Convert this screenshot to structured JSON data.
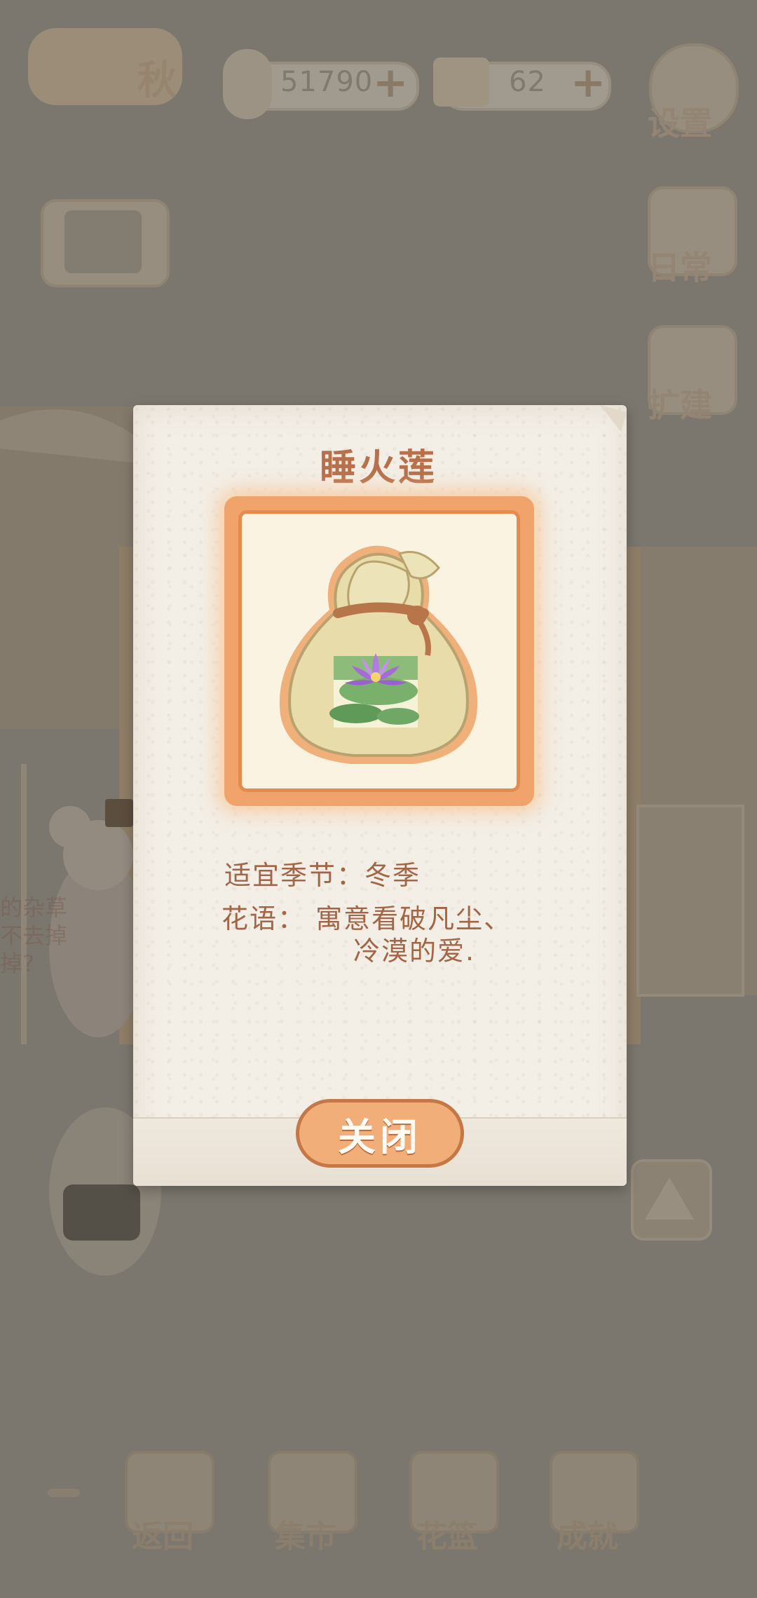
{
  "hud": {
    "season_label": "秋",
    "fish_count": "51790",
    "cheese_count": "62",
    "settings_label": "设置",
    "daily_label": "日常",
    "expand_label": "扩建"
  },
  "bottom_nav": [
    {
      "label": "返回"
    },
    {
      "label": "集市"
    },
    {
      "label": "花篮"
    },
    {
      "label": "成就"
    }
  ],
  "background_text": [
    "的杂草",
    "不去掉",
    "掉?"
  ],
  "dialog": {
    "title": "睡火莲",
    "item_icon": "seed-bag-water-lily-icon",
    "season_line": "适宜季节：冬季",
    "flower_language_line1": "花语： 寓意看破凡尘、",
    "flower_language_line2": "冷漠的爱.",
    "close_label": "关闭"
  },
  "colors": {
    "overlay": "#7b776f",
    "title": "#b7704a",
    "frame": "#f0a36a",
    "button": "#f1ae78"
  }
}
